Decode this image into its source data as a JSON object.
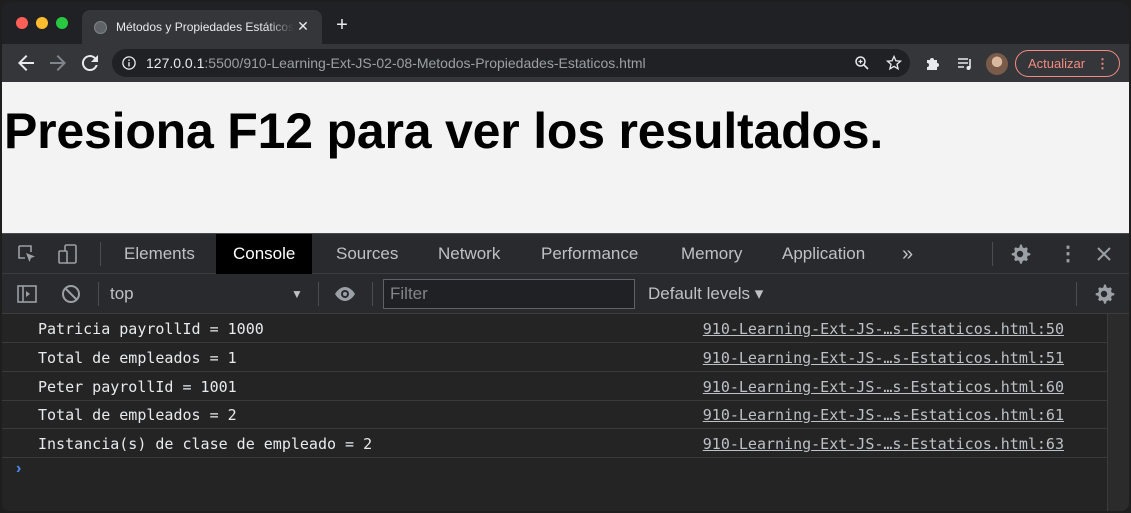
{
  "browser": {
    "tab_title": "Métodos y Propiedades Estáticos",
    "url_host": "127.0.0.1",
    "url_rest": ":5500/910-Learning-Ext-JS-02-08-Metodos-Propiedades-Estaticos.html",
    "update_label": "Actualizar"
  },
  "page": {
    "heading": "Presiona F12 para ver los resultados."
  },
  "devtools": {
    "tabs": [
      "Elements",
      "Console",
      "Sources",
      "Network",
      "Performance",
      "Memory",
      "Application"
    ],
    "active_tab": "Console",
    "more_label": "»",
    "context": "top",
    "filter_placeholder": "Filter",
    "levels_label": "Default levels ▾"
  },
  "console": {
    "logs": [
      {
        "message": "Patricia payrollId = 1000",
        "source": "910-Learning-Ext-JS-…s-Estaticos.html:50"
      },
      {
        "message": "Total de empleados = 1",
        "source": "910-Learning-Ext-JS-…s-Estaticos.html:51"
      },
      {
        "message": "Peter payrollId = 1001",
        "source": "910-Learning-Ext-JS-…s-Estaticos.html:60"
      },
      {
        "message": "Total de empleados = 2",
        "source": "910-Learning-Ext-JS-…s-Estaticos.html:61"
      },
      {
        "message": "Instancia(s) de clase de empleado = 2",
        "source": "910-Learning-Ext-JS-…s-Estaticos.html:63"
      }
    ],
    "prompt_symbol": "›"
  },
  "colors": {
    "accent": "#f28b82",
    "prompt": "#4e8cf5",
    "page_bg": "#f3f3f3"
  }
}
